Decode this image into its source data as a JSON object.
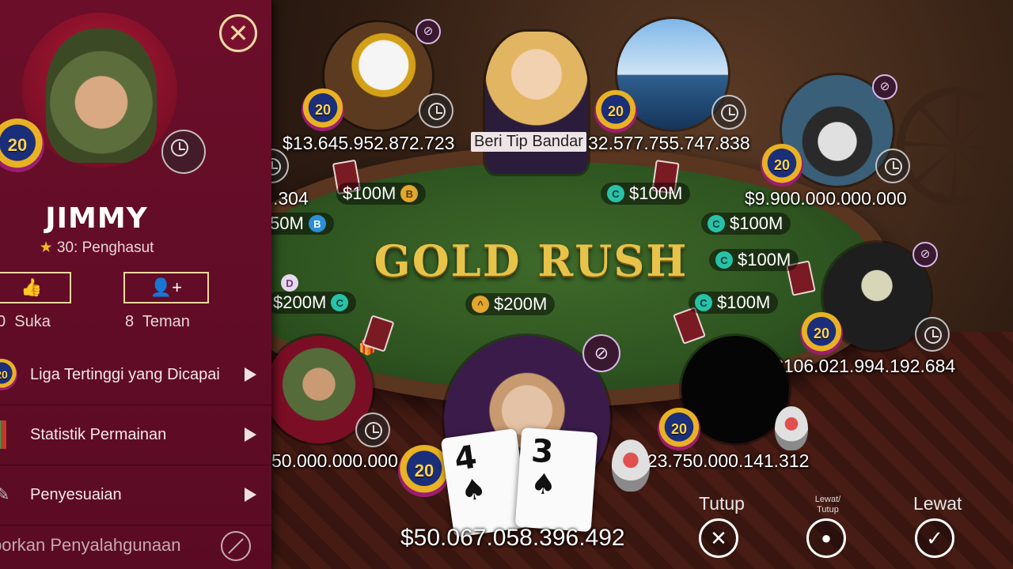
{
  "table": {
    "logo_text": "GOLD RUSH",
    "pot": "$200M",
    "tip_dealer_label": "Beri Tip Bandar"
  },
  "players": {
    "eagle": {
      "balance": "$13.645.952.872.723",
      "bet": "$100M",
      "bet_chip": "B"
    },
    "yacht": {
      "balance": "32.577.755.747.838",
      "bet": "$100M",
      "bet_chip": "C"
    },
    "skull": {
      "balance": "$9.900.000.000.000",
      "bet": "$100M",
      "bet_chip": "C"
    },
    "masked": {
      "balance": "$106.021.994.192.684",
      "bet": "$100M",
      "bet_chip": "C"
    },
    "right_empty": {
      "balance": "$23.750.000.141.312",
      "bet": "$100M",
      "bet_chip": "C"
    },
    "left_soldier": {
      "balance": "50.000.000.000",
      "bet": "$200M",
      "bet_chip": "C"
    },
    "left_top": {
      "balance": ".304",
      "bet": "50M",
      "bet_chip": "B"
    },
    "hero": {
      "balance": "$50.067.058.396.492"
    }
  },
  "hero_cards": [
    {
      "rank": "4",
      "suit": "♠"
    },
    {
      "rank": "3",
      "suit": "♠"
    }
  ],
  "dealer_chip": "D",
  "badge_level": "20",
  "actions": {
    "fold_label": "Tutup",
    "check_fold_label_line1": "Lewat/",
    "check_fold_label_line2": "Tutup",
    "check_label": "Lewat"
  },
  "profile": {
    "name": "JIMMY",
    "rank": "30: Penghasut",
    "likes_count": "0",
    "likes_label": "Suka",
    "friends_count": "8",
    "friends_label": "Teman",
    "menu": [
      {
        "label": "Liga Tertinggi yang Dicapai"
      },
      {
        "label": "Statistik Permainan"
      },
      {
        "label": "Penyesuaian"
      }
    ],
    "report_label": "porkan Penyalahgunaan"
  }
}
